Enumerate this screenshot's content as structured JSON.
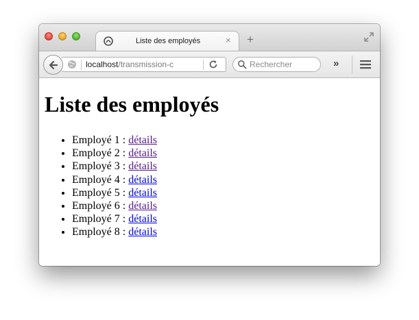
{
  "browser": {
    "tab_title": "Liste des employés",
    "tab_close": "×",
    "new_tab": "+",
    "url_host": "localhost",
    "url_path": "/transmission-c",
    "search_placeholder": "Rechercher",
    "overflow": "»"
  },
  "page": {
    "heading": "Liste des employés",
    "employees": [
      {
        "label": "Employé 1 : ",
        "link": "détails",
        "visited": true
      },
      {
        "label": "Employé 2 : ",
        "link": "détails",
        "visited": true
      },
      {
        "label": "Employé 3 : ",
        "link": "détails",
        "visited": true
      },
      {
        "label": "Employé 4 : ",
        "link": "détails",
        "visited": false
      },
      {
        "label": "Employé 5 : ",
        "link": "détails",
        "visited": false
      },
      {
        "label": "Employé 6 : ",
        "link": "détails",
        "visited": true
      },
      {
        "label": "Employé 7 : ",
        "link": "détails",
        "visited": false
      },
      {
        "label": "Employé 8 : ",
        "link": "détails",
        "visited": false
      }
    ]
  },
  "colors": {
    "link": "#0000ee",
    "visited_link": "#551a8b"
  },
  "icons": {
    "close": "close-icon",
    "minimize": "minimize-icon",
    "maximize": "maximize-icon",
    "favicon": "favicon-icon",
    "back": "back-arrow-icon",
    "globe": "globe-icon",
    "reload": "reload-icon",
    "search": "search-icon",
    "menu": "hamburger-menu-icon",
    "fullscreen": "fullscreen-icon"
  }
}
